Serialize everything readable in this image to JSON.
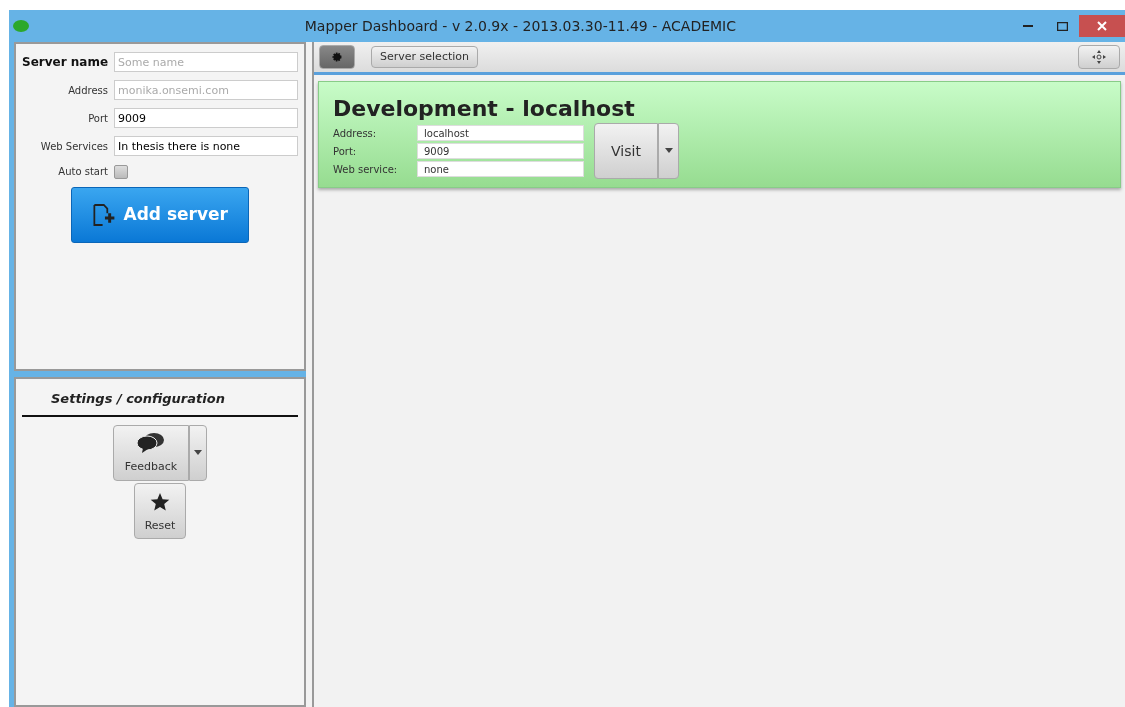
{
  "window": {
    "title": "Mapper Dashboard - v 2.0.9x - 2013.03.30-11.49 - ACADEMIC"
  },
  "server_form": {
    "fields": [
      {
        "label": "Server name",
        "kind": "heading",
        "placeholder": "Some name"
      },
      {
        "label": "Address",
        "kind": "plain",
        "placeholder": "monika.onsemi.com"
      },
      {
        "label": "Port",
        "kind": "plain",
        "value": "9009"
      },
      {
        "label": "Web Services",
        "kind": "plain",
        "value": "In thesis there is none"
      }
    ],
    "auto_start": {
      "label": "Auto start",
      "checked": false
    },
    "add_button": "Add server"
  },
  "settings": {
    "title": "Settings / configuration",
    "buttons": [
      {
        "label": "Feedback",
        "kind": "split"
      },
      {
        "label": "Reset",
        "kind": "plain"
      }
    ]
  },
  "toolbar": {
    "tabs": [
      {
        "label": "Server selection",
        "selected": false
      }
    ]
  },
  "server_card": {
    "title": "Development - localhost",
    "fields": [
      {
        "label": "Address:",
        "value": "localhost"
      },
      {
        "label": "Port:",
        "value": "9009"
      },
      {
        "label": "Web service:",
        "value": "none"
      }
    ],
    "visit_button": "Visit"
  }
}
